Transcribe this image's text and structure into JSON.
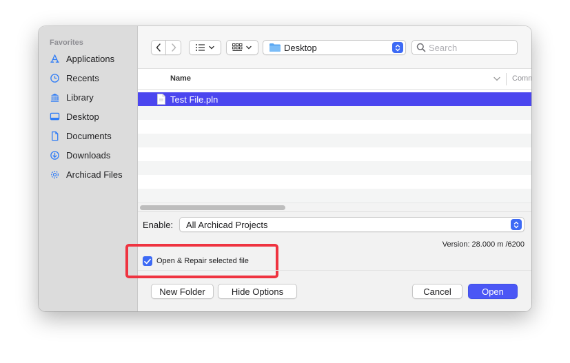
{
  "sidebar": {
    "header": "Favorites",
    "items": [
      {
        "label": "Applications",
        "icon": "applications-icon"
      },
      {
        "label": "Recents",
        "icon": "clock-icon"
      },
      {
        "label": "Library",
        "icon": "library-icon"
      },
      {
        "label": "Desktop",
        "icon": "desktop-icon"
      },
      {
        "label": "Documents",
        "icon": "document-icon"
      },
      {
        "label": "Downloads",
        "icon": "download-icon"
      },
      {
        "label": "Archicad Files",
        "icon": "gear-icon"
      }
    ]
  },
  "toolbar": {
    "location": "Desktop",
    "search_placeholder": "Search"
  },
  "list": {
    "columns": [
      "Name",
      "Comm"
    ],
    "files": [
      {
        "name": "Test File.pln",
        "selected": true
      }
    ]
  },
  "options": {
    "enable_label": "Enable:",
    "enable_value": "All Archicad Projects",
    "version": "Version: 28.000 m /6200",
    "checkbox_label": "Open & Repair selected file",
    "checkbox_checked": true
  },
  "buttons": {
    "new_folder": "New Folder",
    "hide_options": "Hide Options",
    "cancel": "Cancel",
    "open": "Open"
  },
  "colors": {
    "accent": "#4b46ef",
    "highlight": "#ef3340",
    "primary_button": "#4b57f5"
  }
}
